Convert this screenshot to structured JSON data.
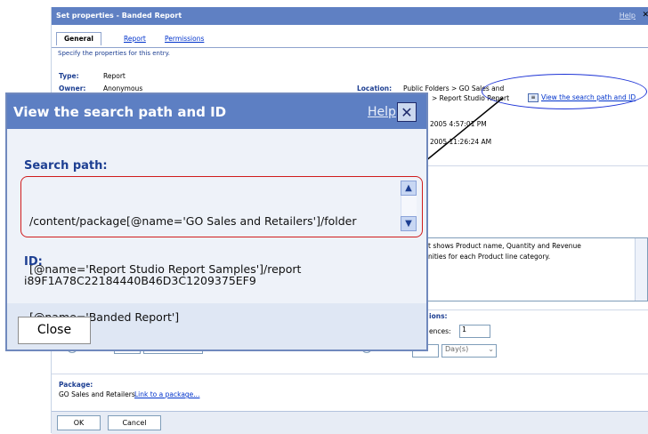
{
  "background": {
    "title": "Set properties - Banded Report",
    "help": "Help",
    "close": "✕",
    "tabs": [
      "General",
      "Report",
      "Permissions"
    ],
    "specify_text": "Specify the properties for this entry.",
    "type_label": "Type:",
    "type_value": "Report",
    "owner_label": "Owner:",
    "owner_value": "Anonymous",
    "location_label": "Location:",
    "location_line1": "Public Folders > GO Sales and",
    "location_line2": "> Report Studio Report",
    "view_link": "View the search path and ID",
    "date1": "2005 4:57:01 PM",
    "date2": "2005 11:26:24 AM",
    "desc_line1": "t shows Product name, Quantity and Revenue",
    "desc_line2": "nities for each Product line category.",
    "options_label": "ions:",
    "occurrences_label": "ences:",
    "occurrences_value": "1",
    "days_value": "Day(s)",
    "package_label": "Package:",
    "package_value": "GO Sales and Retailers",
    "package_link": "Link to a package...",
    "ok": "OK",
    "cancel": "Cancel"
  },
  "dialog": {
    "title": "View the search path and ID",
    "help": "Help",
    "close_x": "✕",
    "search_path_label": "Search path:",
    "search_path_line1": "/content/package[@name='GO Sales and Retailers']/folder",
    "search_path_line2": "[@name='Report Studio Report Samples']/report",
    "search_path_line3": "[@name='Banded Report']",
    "id_label": "ID:",
    "id_value": "i89F1A78C22184440B46D3C1209375EF9",
    "close_button": "Close"
  },
  "colors": {
    "title_bar": "#5d7fc3",
    "annotation_ellipse": "#1d33d6",
    "annotation_box": "#d01c1c"
  }
}
